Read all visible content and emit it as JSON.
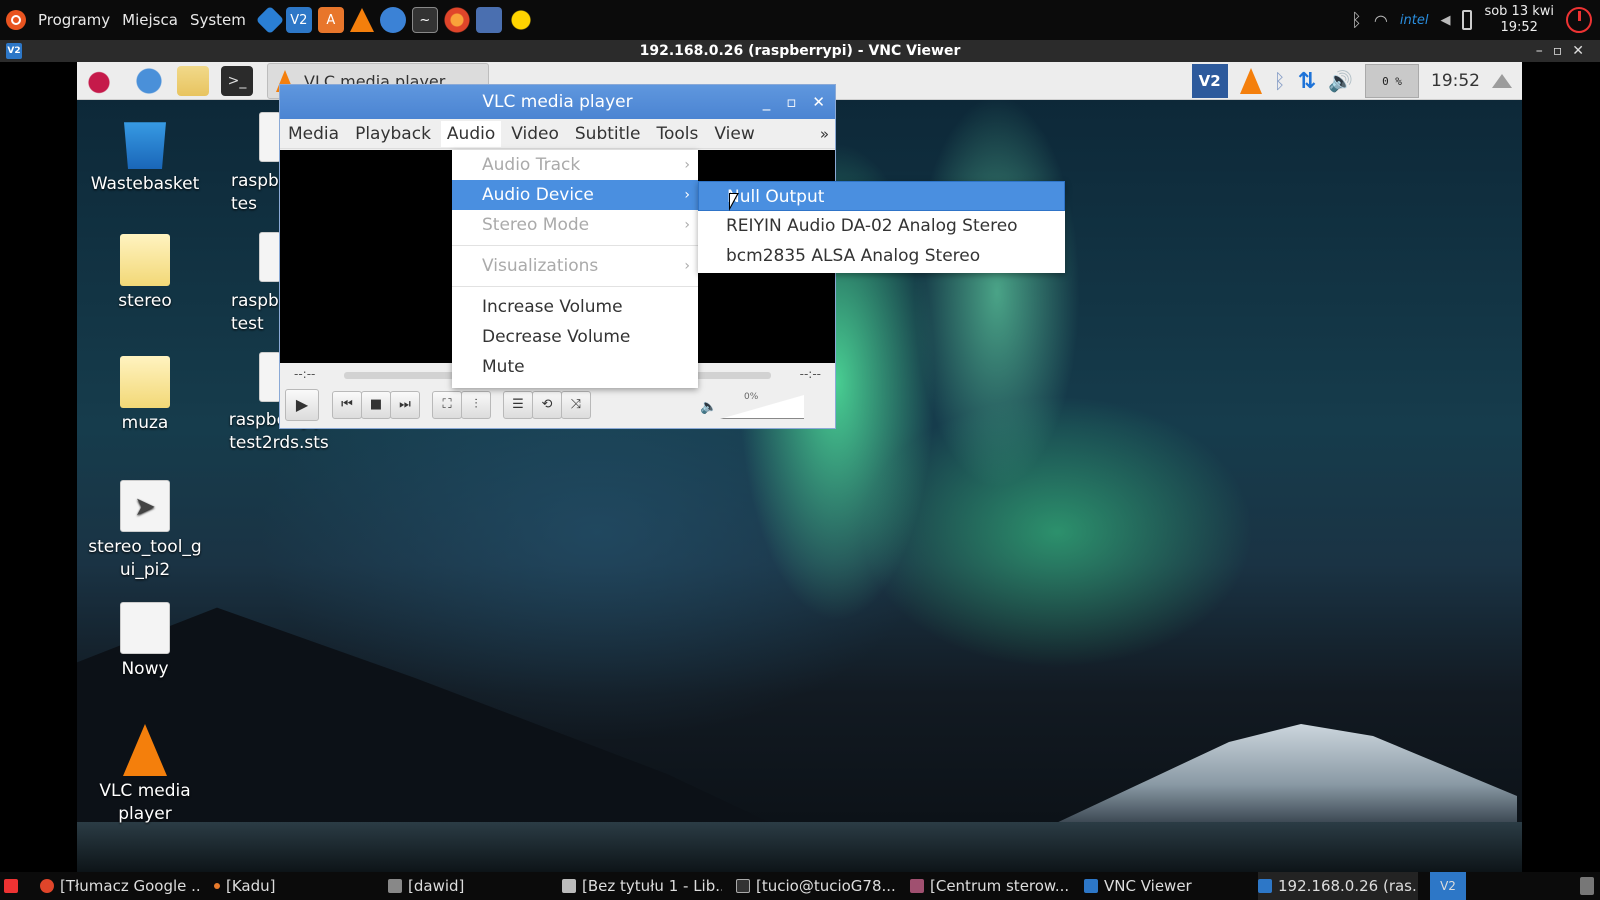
{
  "host_topbar": {
    "menu": [
      "Programy",
      "Miejsca",
      "System"
    ],
    "launchers": [
      "kadu-icon",
      "vnc-icon",
      "software-icon",
      "vlc-icon",
      "mail-icon",
      "monitor-icon",
      "firefox-icon",
      "network-icon",
      "weather-icon"
    ],
    "clock_line1": "sob 13 kwi",
    "clock_line2": "19:52",
    "cpu_brand": "intel"
  },
  "vnc": {
    "title": "192.168.0.26 (raspberrypi) - VNC Viewer",
    "badge": "V2"
  },
  "pi_panel": {
    "task_button": "VLC media player",
    "vnc_badge": "V2",
    "cpu": "0 %",
    "clock": "19:52"
  },
  "desktop_icons": [
    {
      "label": "Wastebasket"
    },
    {
      "label": "stereo"
    },
    {
      "label": "muza"
    },
    {
      "label": "stereo_tool_gui_pi2"
    },
    {
      "label": "Nowy"
    },
    {
      "label": "VLC media player"
    },
    {
      "label": "raspb tes"
    },
    {
      "label": "raspb test"
    },
    {
      "label": "raspberry.pi test2rds.sts"
    }
  ],
  "vlc": {
    "title": "VLC media player",
    "menu": [
      "Media",
      "Playback",
      "Audio",
      "Video",
      "Subtitle",
      "Tools",
      "View"
    ],
    "more": "»",
    "time_elapsed": "--:--",
    "time_total": "--:--",
    "volume_pct": "0%"
  },
  "audio_menu": {
    "audio_track": "Audio Track",
    "audio_device": "Audio Device",
    "stereo_mode": "Stereo Mode",
    "visualizations": "Visualizations",
    "increase_volume": "Increase Volume",
    "decrease_volume": "Decrease Volume",
    "mute": "Mute"
  },
  "device_menu": [
    "Null Output",
    "REIYIN Audio DA-02 Analog Stereo",
    "bcm2835 ALSA Analog Stereo"
  ],
  "taskbar": [
    "[Tłumacz Google ...",
    "[Kadu]",
    "[dawid]",
    "[Bez tytułu 1 - Lib...",
    "[tucio@tucioG78...",
    "[Centrum sterow...",
    "VNC Viewer",
    "192.168.0.26 (ras..."
  ],
  "taskbar_tray": "V2"
}
